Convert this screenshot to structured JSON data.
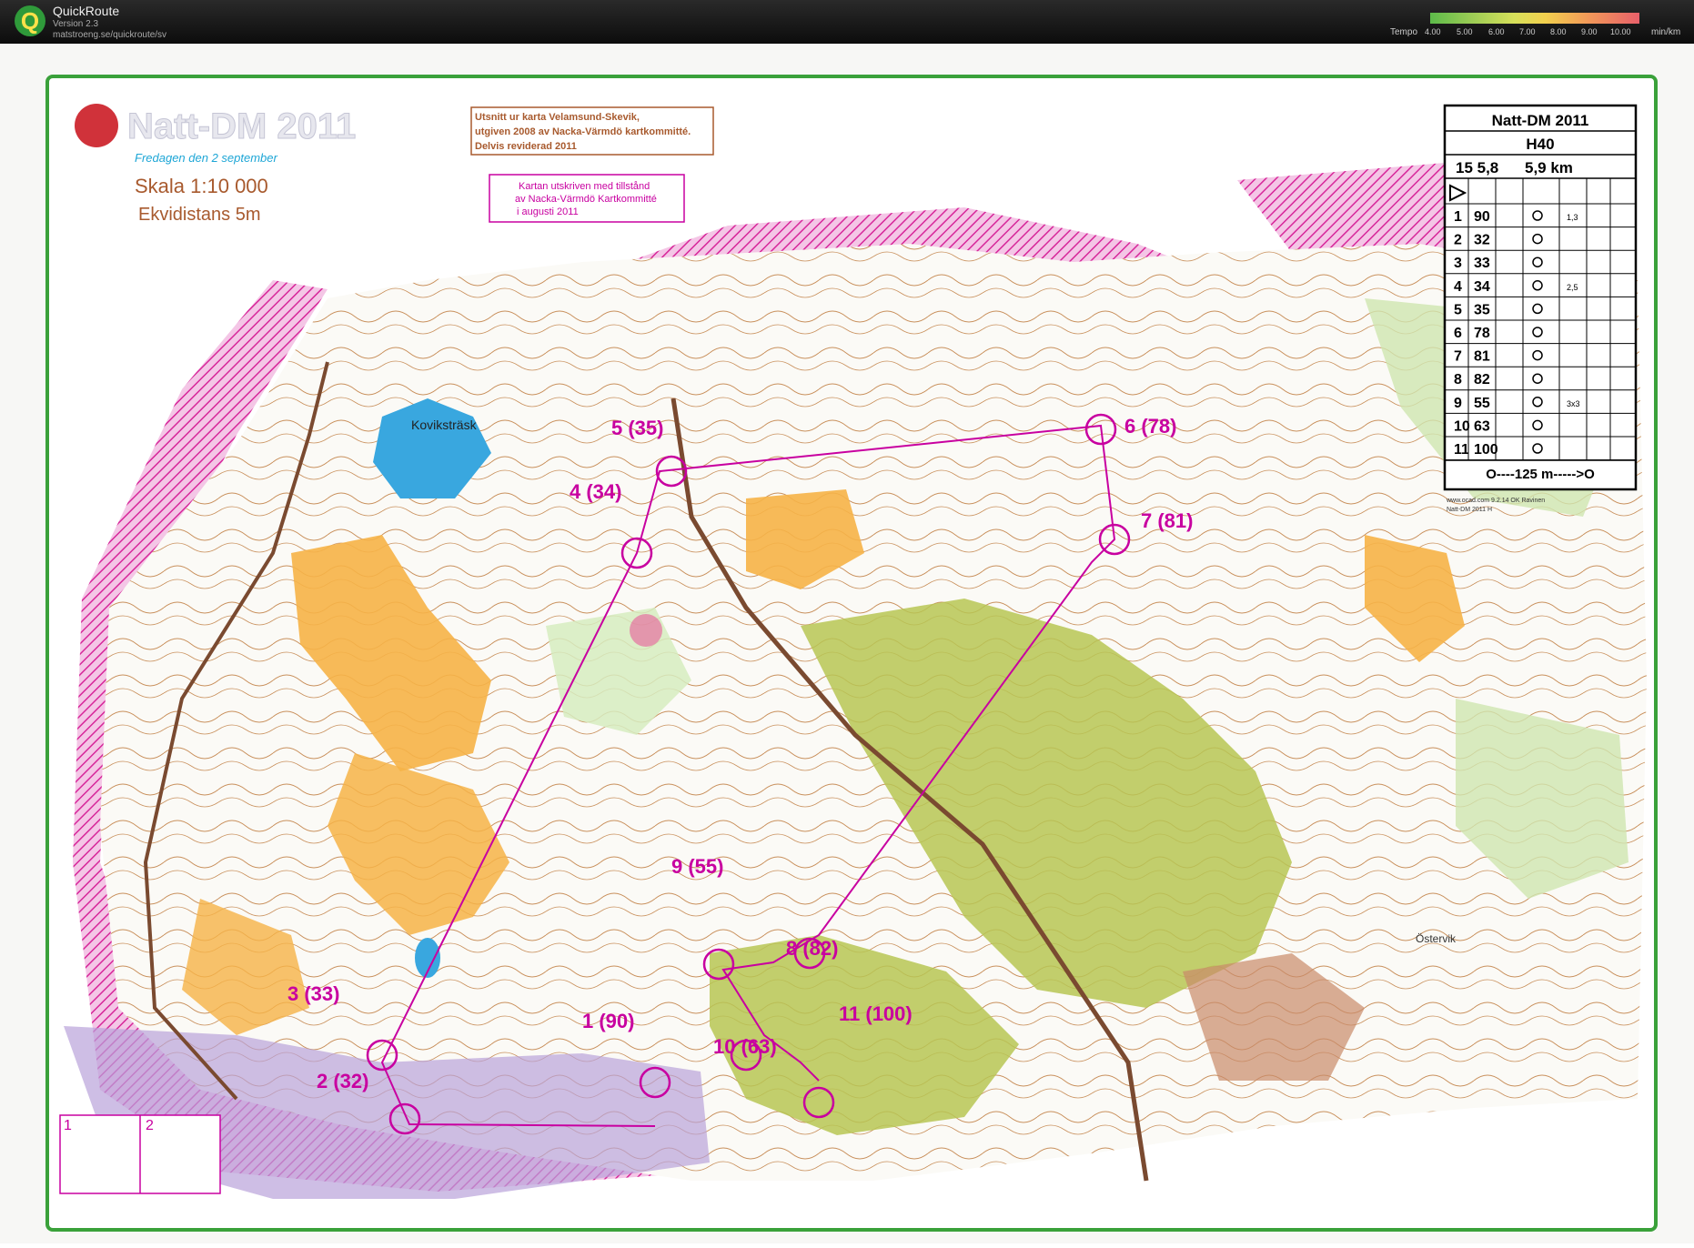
{
  "app": {
    "title": "QuickRoute",
    "version": "Version 2.3",
    "url": "matstroeng.se/quickroute/sv",
    "logo_letter": "Q"
  },
  "tempo": {
    "label": "Tempo",
    "ticks": [
      "4.00",
      "5.00",
      "6.00",
      "7.00",
      "8.00",
      "9.00",
      "10.00"
    ],
    "unit": "min/km"
  },
  "map": {
    "title": "Natt-DM 2011",
    "date": "Fredagen den 2 september",
    "scale": "Skala 1:10 000",
    "contour": "Ekvidistans 5m",
    "note1": [
      "Utsnitt ur karta Velamsund-Skevik,",
      "utgiven 2008 av Nacka-Värmdö kartkommitté.",
      "Delvis reviderad 2011"
    ],
    "note2": [
      "Kartan utskriven med tillstånd",
      "av Nacka-Värmdö Kartkommitté",
      "i augusti 2011"
    ],
    "lake_name": "Koviksträsk",
    "place_name": "Östervik",
    "print_note": [
      "www.ocad.com 9.2.14 OK Ravinen",
      "Natt-DM 2011 H"
    ],
    "box": [
      "1",
      "2"
    ]
  },
  "controls": [
    {
      "label": "1 (90)"
    },
    {
      "label": "2 (32)"
    },
    {
      "label": "3 (33)"
    },
    {
      "label": "4 (34)"
    },
    {
      "label": "5 (35)"
    },
    {
      "label": "6 (78)"
    },
    {
      "label": "7 (81)"
    },
    {
      "label": "8 (82)"
    },
    {
      "label": "9 (55)"
    },
    {
      "label": "10 (63)"
    },
    {
      "label": "11 (100)"
    }
  ],
  "description": {
    "title": "Natt-DM 2011",
    "class": "H40",
    "course": "15 5,8",
    "length": "5,9 km",
    "rows": [
      {
        "no": "1",
        "code": "90",
        "extra": "1,3"
      },
      {
        "no": "2",
        "code": "32",
        "extra": ""
      },
      {
        "no": "3",
        "code": "33",
        "extra": ""
      },
      {
        "no": "4",
        "code": "34",
        "extra": "2,5"
      },
      {
        "no": "5",
        "code": "35",
        "extra": ""
      },
      {
        "no": "6",
        "code": "78",
        "extra": ""
      },
      {
        "no": "7",
        "code": "81",
        "extra": ""
      },
      {
        "no": "8",
        "code": "82",
        "extra": ""
      },
      {
        "no": "9",
        "code": "55",
        "extra": "3x3"
      },
      {
        "no": "10",
        "code": "63",
        "extra": ""
      },
      {
        "no": "11",
        "code": "100",
        "extra": ""
      }
    ],
    "finish": "O----125 m----->O"
  }
}
